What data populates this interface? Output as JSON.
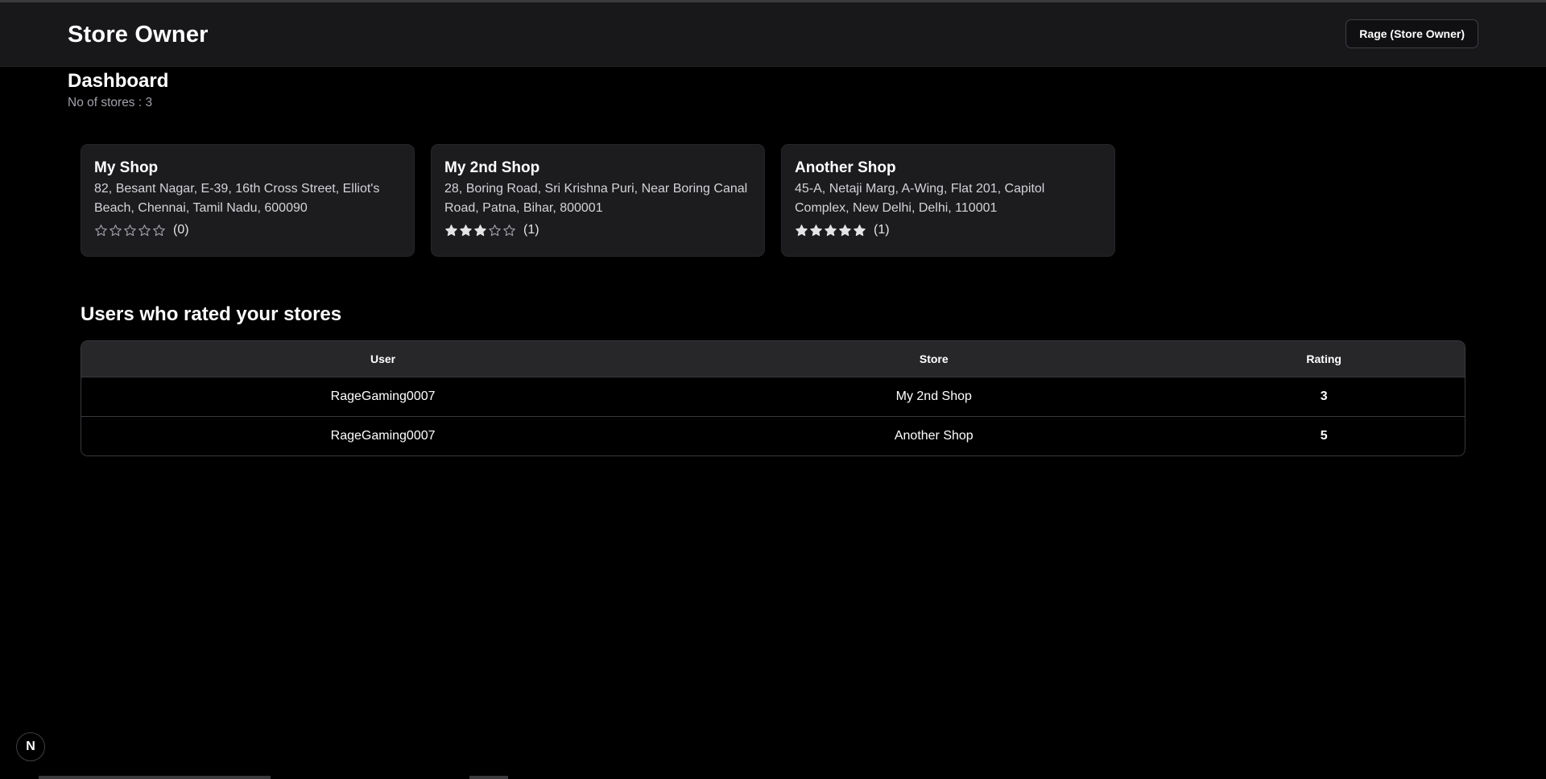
{
  "header": {
    "title": "Store Owner",
    "user_label": "Rage (Store Owner)"
  },
  "dashboard": {
    "title": "Dashboard",
    "store_count_text": "No of stores : 3"
  },
  "stores": [
    {
      "name": "My Shop",
      "address": "82, Besant Nagar, E-39, 16th Cross Street, Elliot's Beach, Chennai, Tamil Nadu, 600090",
      "rating": 0,
      "rating_count": "(0)"
    },
    {
      "name": "My 2nd Shop",
      "address": "28, Boring Road, Sri Krishna Puri, Near Boring Canal Road, Patna, Bihar, 800001",
      "rating": 3,
      "rating_count": "(1)"
    },
    {
      "name": "Another Shop",
      "address": "45-A, Netaji Marg, A-Wing, Flat 201, Capitol Complex, New Delhi, Delhi, 110001",
      "rating": 5,
      "rating_count": "(1)"
    }
  ],
  "ratings_section": {
    "title": "Users who rated your stores",
    "columns": [
      "User",
      "Store",
      "Rating"
    ],
    "rows": [
      {
        "user": "RageGaming0007",
        "store": "My 2nd Shop",
        "rating": "3"
      },
      {
        "user": "RageGaming0007",
        "store": "Another Shop",
        "rating": "5"
      }
    ]
  },
  "dev_badge": {
    "label": "N"
  },
  "colors": {
    "background": "#000000",
    "header_bg": "#18181b",
    "card_bg": "#1c1c1f",
    "table_header_bg": "#27272a",
    "muted_text": "#a1a1aa"
  }
}
